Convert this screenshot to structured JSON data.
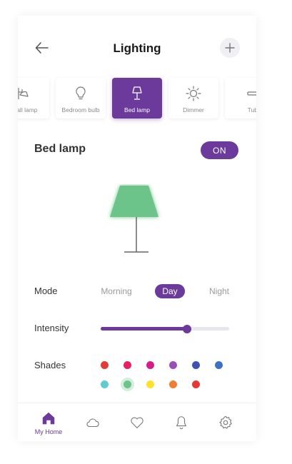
{
  "header": {
    "title": "Lighting"
  },
  "devices": [
    {
      "label": "Wall lamp",
      "icon": "wall-lamp-icon"
    },
    {
      "label": "Bedroom bulb",
      "icon": "bulb-icon"
    },
    {
      "label": "Bed lamp",
      "icon": "table-lamp-icon",
      "active": true
    },
    {
      "label": "Dimmer",
      "icon": "sun-icon"
    },
    {
      "label": "Tubelight",
      "icon": "tubelight-icon"
    }
  ],
  "device": {
    "name": "Bed lamp",
    "power_label": "ON"
  },
  "mode": {
    "label": "Mode",
    "options": [
      "Morning",
      "Day",
      "Night"
    ],
    "selected": "Day"
  },
  "intensity": {
    "label": "Intensity",
    "value": 0.67
  },
  "shades": {
    "label": "Shades",
    "colors": [
      "#e53935",
      "#e91e63",
      "#d81b8c",
      "#9b4fb5",
      "#3f51b5",
      "#3d6fc7",
      "#5ecbd2",
      "#6cc48a",
      "#ffe02b",
      "#f17e35",
      "#e53935"
    ],
    "selected_index": 7
  },
  "lamp_color": "#6cc48a",
  "accent_color": "#6b3a9a",
  "bottom_nav": [
    {
      "label": "My Home",
      "icon": "home-icon",
      "active": true
    },
    {
      "label": "",
      "icon": "cloud-icon"
    },
    {
      "label": "",
      "icon": "heart-icon"
    },
    {
      "label": "",
      "icon": "bell-icon"
    },
    {
      "label": "",
      "icon": "settings-icon"
    }
  ]
}
